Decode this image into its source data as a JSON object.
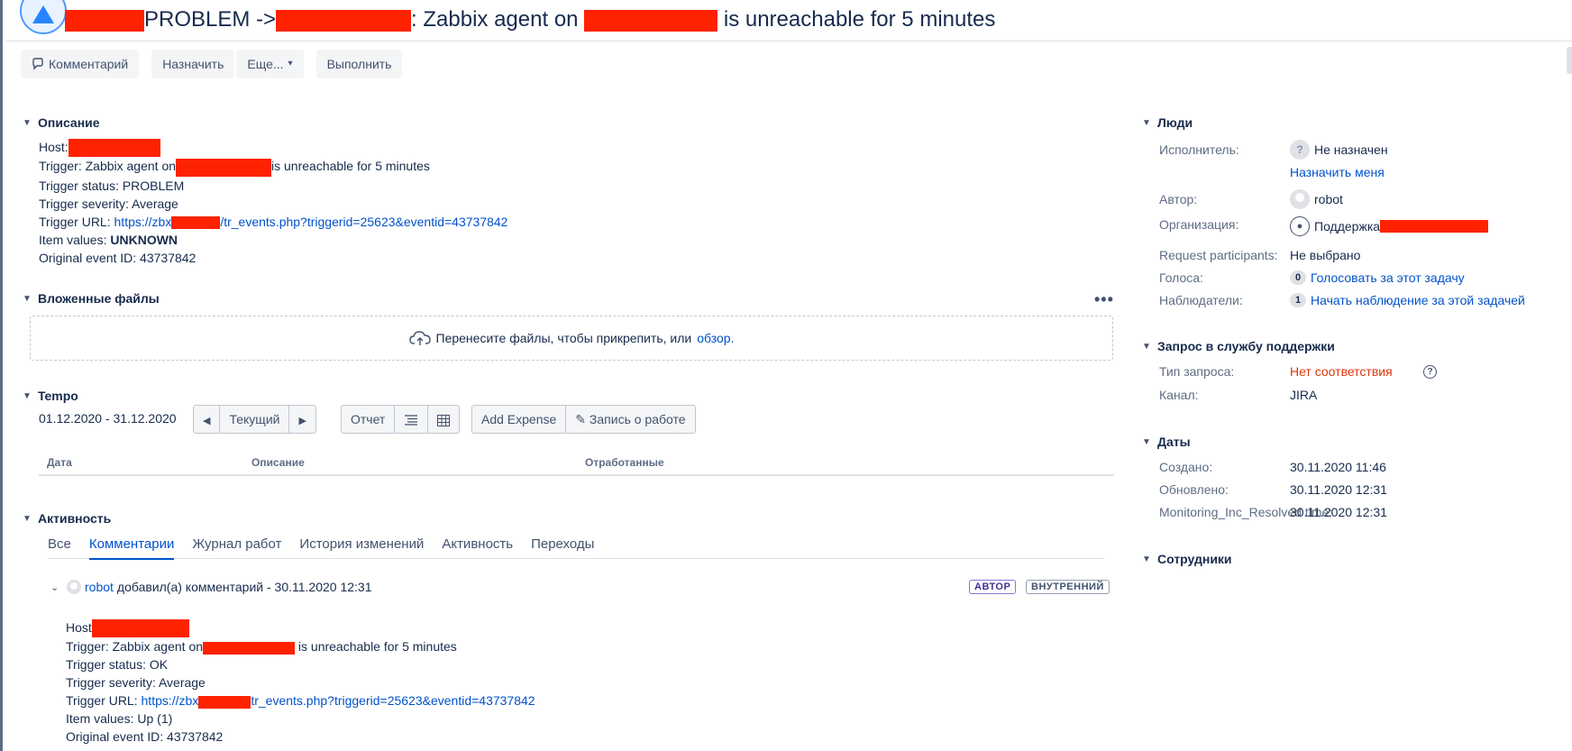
{
  "header": {
    "title_prefix": "PROBLEM ->",
    "title_middle": ": Zabbix agent on",
    "title_suffix": "is unreachable for 5 minutes"
  },
  "toolbar": {
    "comment": "Комментарий",
    "assign": "Назначить",
    "more": "Еще...",
    "execute": "Выполнить"
  },
  "description": {
    "heading": "Описание",
    "host_label": "Host:",
    "trigger_pre": "Trigger: Zabbix agent on",
    "trigger_post": "is unreachable for 5 minutes",
    "status": "Trigger status: PROBLEM",
    "severity": "Trigger severity: Average",
    "url_label": "Trigger URL: ",
    "url_pre": "https://zbx",
    "url_post": "/tr_events.php?triggerid=25623&eventid=43737842",
    "item_label": "Item values: ",
    "item_value": "UNKNOWN",
    "original": "Original event ID: 43737842"
  },
  "attachments": {
    "heading": "Вложенные файлы",
    "more": "•••",
    "drop_text": "Перенесите файлы, чтобы прикрепить, или",
    "browse": "обзор",
    "dot": "."
  },
  "tempo": {
    "heading": "Tempo",
    "range": "01.12.2020 - 31.12.2020",
    "current": "Текущий",
    "report": "Отчет",
    "add_expense": "Add Expense",
    "log_work": "Запись о работе",
    "columns": [
      "Дата",
      "Описание",
      "Отработанные"
    ]
  },
  "activity": {
    "heading": "Активность",
    "tabs": [
      "Все",
      "Комментарии",
      "Журнал работ",
      "История изменений",
      "Активность",
      "Переходы"
    ],
    "comment": {
      "author": "robot",
      "action": "добавил(а) комментарий - 30.11.2020 12:31",
      "badge_author": "АВТОР",
      "badge_internal": "ВНУТРЕННИЙ",
      "host_label": "Host",
      "trigger_pre": "Trigger: Zabbix agent on",
      "trigger_post": "is unreachable for 5 minutes",
      "status": "Trigger status: OK",
      "severity": "Trigger severity: Average",
      "url_label": "Trigger URL: ",
      "url_pre": "https://zbx",
      "url_post": "tr_events.php?triggerid=25623&eventid=43737842",
      "item": "Item values: Up (1)",
      "original": "Original event ID: 43737842"
    }
  },
  "people": {
    "heading": "Люди",
    "assignee_label": "Исполнитель:",
    "assignee_value": "Не назначен",
    "assign_me": "Назначить меня",
    "reporter_label": "Автор:",
    "reporter_value": "robot",
    "org_label": "Организация:",
    "org_value": "Поддержка",
    "participants_label": "Request participants:",
    "participants_value": "Не выбрано",
    "votes_label": "Голоса:",
    "votes_count": "0",
    "votes_link": "Голосовать за этот задачу",
    "watchers_label": "Наблюдатели:",
    "watchers_count": "1",
    "watchers_link": "Начать наблюдение за этой задачей"
  },
  "service_request": {
    "heading": "Запрос в службу поддержки",
    "type_label": "Тип запроса:",
    "type_value": "Нет соответствия",
    "channel_label": "Канал:",
    "channel_value": "JIRA"
  },
  "dates": {
    "heading": "Даты",
    "created_label": "Создано:",
    "created_value": "30.11.2020 11:46",
    "updated_label": "Обновлено:",
    "updated_value": "30.11.2020 12:31",
    "resolved_label": "Monitoring_Inc_Resolved time:",
    "resolved_value": "30.11.2020 12:31"
  },
  "employees": {
    "heading": "Сотрудники"
  },
  "colors": {
    "link": "#0052cc",
    "redaction": "#ff2200",
    "no_match": "#de350b"
  }
}
